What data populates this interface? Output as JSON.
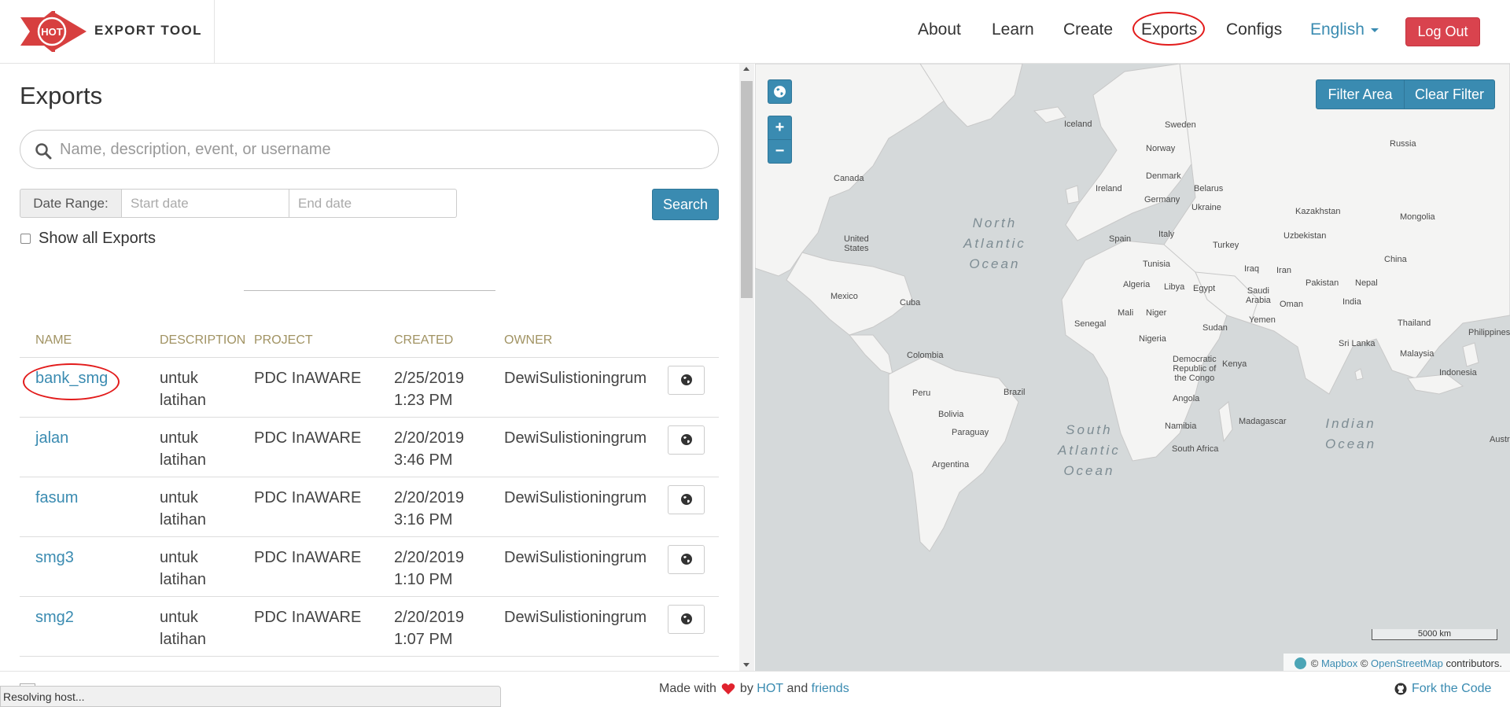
{
  "brand": {
    "name": "EXPORT TOOL",
    "logo_text": "HOT"
  },
  "nav": {
    "about": "About",
    "learn": "Learn",
    "create": "Create",
    "exports": "Exports",
    "configs": "Configs",
    "language": "English",
    "logout": "Log Out"
  },
  "page": {
    "title": "Exports",
    "search_placeholder": "Name, description, event, or username",
    "date_range_label": "Date Range:",
    "start_placeholder": "Start date",
    "end_placeholder": "End date",
    "search_button": "Search",
    "show_all_label": "Show all Exports"
  },
  "table": {
    "headers": {
      "name": "NAME",
      "description": "DESCRIPTION",
      "project": "PROJECT",
      "created": "CREATED",
      "owner": "OWNER"
    },
    "rows": [
      {
        "name": "bank_smg",
        "desc1": "untuk",
        "desc2": "latihan",
        "project": "PDC InAWARE",
        "date": "2/25/2019",
        "time": "1:23 PM",
        "owner": "DewiSulistioningrum"
      },
      {
        "name": "jalan",
        "desc1": "untuk",
        "desc2": "latihan",
        "project": "PDC InAWARE",
        "date": "2/20/2019",
        "time": "3:46 PM",
        "owner": "DewiSulistioningrum"
      },
      {
        "name": "fasum",
        "desc1": "untuk",
        "desc2": "latihan",
        "project": "PDC InAWARE",
        "date": "2/20/2019",
        "time": "3:16 PM",
        "owner": "DewiSulistioningrum"
      },
      {
        "name": "smg3",
        "desc1": "untuk",
        "desc2": "latihan",
        "project": "PDC InAWARE",
        "date": "2/20/2019",
        "time": "1:10 PM",
        "owner": "DewiSulistioningrum"
      },
      {
        "name": "smg2",
        "desc1": "untuk",
        "desc2": "latihan",
        "project": "PDC InAWARE",
        "date": "2/20/2019",
        "time": "1:07 PM",
        "owner": "DewiSulistioningrum"
      }
    ]
  },
  "map": {
    "filter_area": "Filter Area",
    "clear_filter": "Clear Filter",
    "zoom_in": "+",
    "zoom_out": "−",
    "scale": "5000 km",
    "attribution": {
      "copy1": "©",
      "mapbox": "Mapbox",
      "copy2": "©",
      "osm": "OpenStreetMap",
      "suffix": "contributors."
    },
    "oceans": {
      "north_atlantic": "North\nAtlantic\nOcean",
      "south_atlantic": "South\nAtlantic\nOcean",
      "indian": "Indian\nOcean"
    },
    "labels": {
      "iceland": "Iceland",
      "sweden": "Sweden",
      "norway": "Norway",
      "russia": "Russia",
      "canada": "Canada",
      "denmark": "Denmark",
      "ireland": "Ireland",
      "belarus": "Belarus",
      "germany": "Germany",
      "ukraine": "Ukraine",
      "kazakhstan": "Kazakhstan",
      "mongolia": "Mongolia",
      "united_states": "United\nStates",
      "spain": "Spain",
      "italy": "Italy",
      "uzbekistan": "Uzbekistan",
      "turkey": "Turkey",
      "china": "China",
      "tunisia": "Tunisia",
      "iraq": "Iraq",
      "iran": "Iran",
      "mexico": "Mexico",
      "cuba": "Cuba",
      "algeria": "Algeria",
      "libya": "Libya",
      "egypt": "Egypt",
      "saudi_arabia": "Saudi\nArabia",
      "pakistan": "Pakistan",
      "nepal": "Nepal",
      "oman": "Oman",
      "india": "India",
      "senegal": "Senegal",
      "mali": "Mali",
      "niger": "Niger",
      "sudan": "Sudan",
      "yemen": "Yemen",
      "thailand": "Thailand",
      "philippines": "Philippines",
      "nigeria": "Nigeria",
      "sri_lanka": "Sri Lanka",
      "malaysia": "Malaysia",
      "colombia": "Colombia",
      "drc": "Democratic\nRepublic of\nthe Congo",
      "kenya": "Kenya",
      "indonesia": "Indonesia",
      "peru": "Peru",
      "brazil": "Brazil",
      "bolivia": "Bolivia",
      "angola": "Angola",
      "paraguay": "Paraguay",
      "madagascar": "Madagascar",
      "namibia": "Namibia",
      "south_africa": "South Africa",
      "argentina": "Argentina",
      "australia": "Austr"
    }
  },
  "footer": {
    "made_with": "Made with",
    "by": "by",
    "hot": "HOT",
    "and": "and",
    "friends": "friends",
    "fork": "Fork the Code"
  },
  "status_bar": "Resolving host...",
  "colors": {
    "accent": "#3a8bb1",
    "logout": "#d9434e",
    "annotation": "#e21b1b",
    "logo_red": "#d73f3f"
  }
}
